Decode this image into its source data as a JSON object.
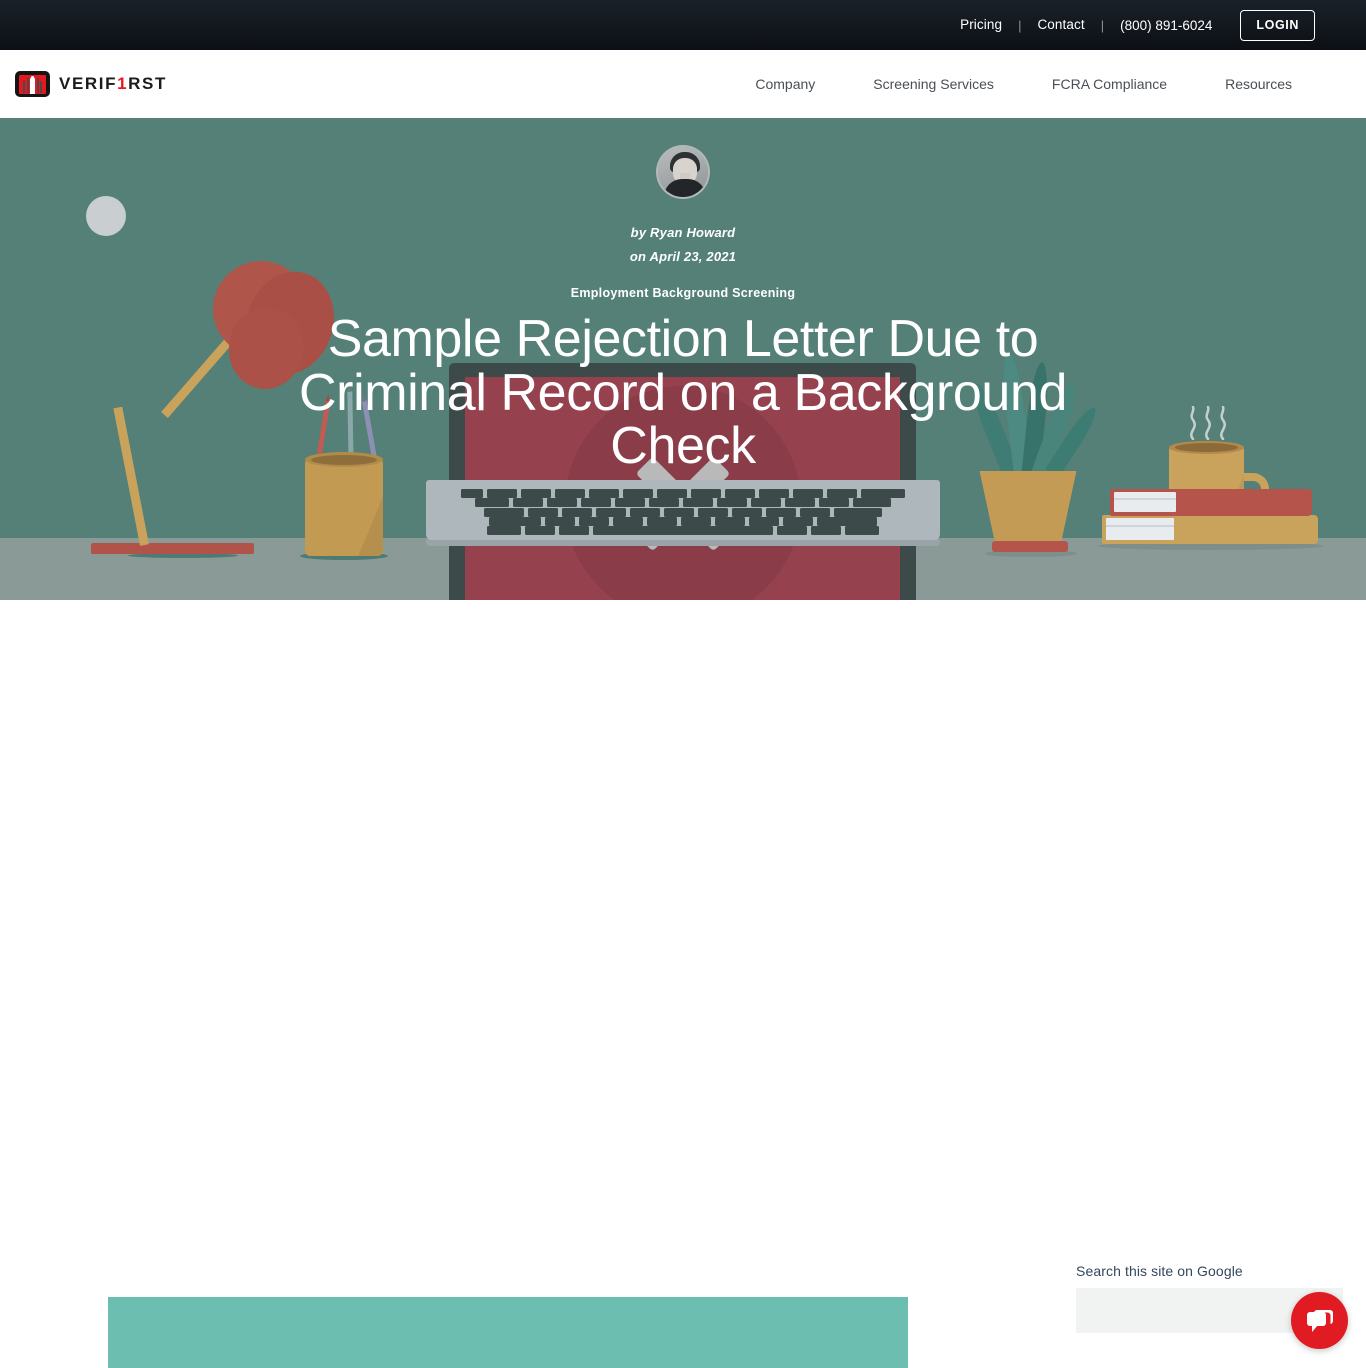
{
  "topbar": {
    "links": [
      {
        "label": "Pricing"
      },
      {
        "label": "Contact"
      }
    ],
    "separator": "|",
    "phone": "(800) 891-6024",
    "login_label": "LOGIN"
  },
  "header": {
    "logo_text_a": "VERIF",
    "logo_text_one": "1",
    "logo_text_b": "RST",
    "nav": [
      {
        "label": "Company"
      },
      {
        "label": "Screening Services"
      },
      {
        "label": "FCRA Compliance"
      },
      {
        "label": "Resources"
      }
    ]
  },
  "hero": {
    "byline": "by Ryan Howard",
    "dateline": "on April 23, 2021",
    "category": "Employment Background Screening",
    "title": "Sample Rejection Letter Due to Criminal Record on a Background Check"
  },
  "sidebar": {
    "search_label": "Search this site on Google",
    "search_value": "",
    "search_placeholder": ""
  },
  "widgets": {
    "chat_icon": "chat-bubbles-icon"
  },
  "colors": {
    "topbar_bg": "#141920",
    "brand_red": "#e8161f",
    "hero_bg": "#548078",
    "desk": "#8a9a96",
    "screen_red": "#95414e",
    "teal_block": "#6cbfb0",
    "chat_red": "#e01b22",
    "nav_text": "#4a4f55"
  }
}
